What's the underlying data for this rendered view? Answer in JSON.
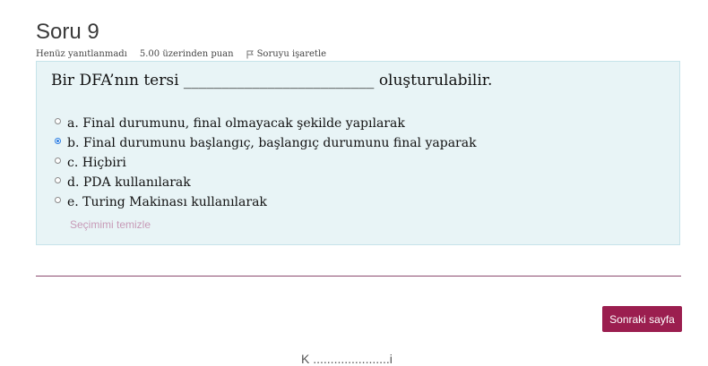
{
  "question": {
    "title": "Soru 9",
    "state": "Henüz yanıtlanmadı",
    "grade": "5.00 üzerinden puan",
    "flag_label": "Soruyu işaretle",
    "text": "Bir DFA’nın tersi _________________________ oluşturulabilir.",
    "answers": [
      {
        "label": "a. Final durumunu, final olmayacak şekilde yapılarak",
        "checked": false
      },
      {
        "label": "b. Final durumunu başlangıç, başlangıç durumunu final yaparak",
        "checked": true
      },
      {
        "label": "c. Hiçbiri",
        "checked": false
      },
      {
        "label": "d. PDA kullanılarak",
        "checked": false
      },
      {
        "label": "e. Turing Makinası kullanılarak",
        "checked": false
      }
    ],
    "clear_choice": "Seçimimi temizle"
  },
  "nav": {
    "next_label": "Sonraki sayfa",
    "footer_cut": "K ......................i"
  },
  "colors": {
    "box_bg": "#e8f4f6",
    "accent": "#9b1e4f",
    "radio_checked": "#2a7de1"
  }
}
